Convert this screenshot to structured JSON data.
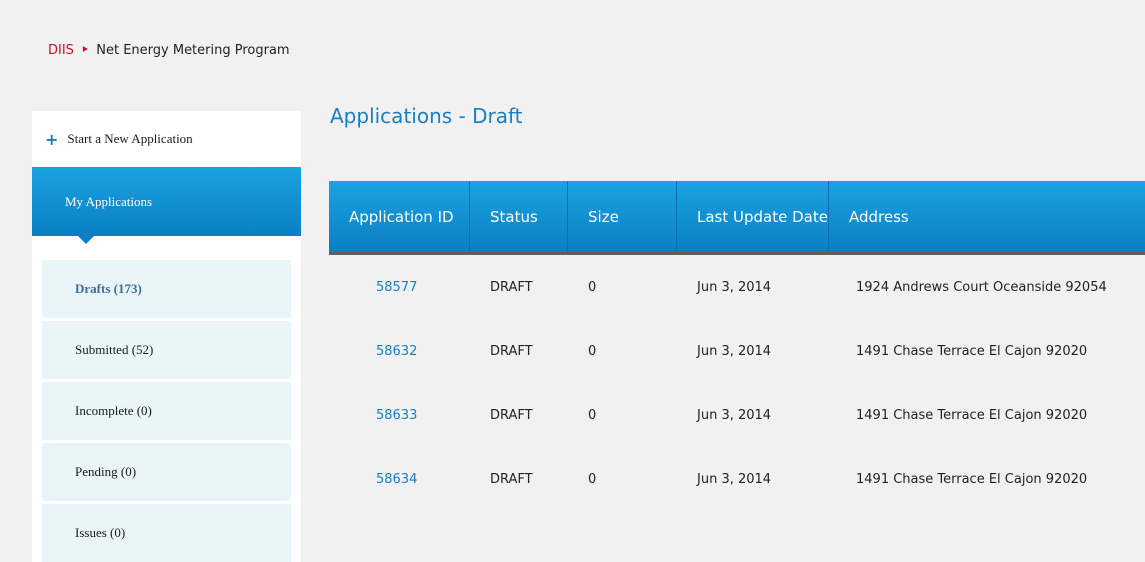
{
  "breadcrumb": {
    "root": "DIIS",
    "separator": "‣",
    "current": "Net Energy Metering Program"
  },
  "sidebar": {
    "new_application": "Start a New Application",
    "my_applications": "My Applications",
    "items": [
      {
        "label": "Drafts (173)",
        "active": true
      },
      {
        "label": "Submitted (52)"
      },
      {
        "label": "Incomplete (0)"
      },
      {
        "label": "Pending (0)"
      },
      {
        "label": "Issues (0)"
      }
    ]
  },
  "main": {
    "title": "Applications - Draft",
    "table": {
      "headers": [
        "Application ID",
        "Status",
        "Size",
        "Last Update Date",
        "Address"
      ],
      "rows": [
        {
          "id": "58577",
          "status": "DRAFT",
          "size": "0",
          "date": "Jun 3, 2014",
          "address": "1924 Andrews Court Oceanside 92054"
        },
        {
          "id": "58632",
          "status": "DRAFT",
          "size": "0",
          "date": "Jun 3, 2014",
          "address": "1491 Chase Terrace El Cajon 92020"
        },
        {
          "id": "58633",
          "status": "DRAFT",
          "size": "0",
          "date": "Jun 3, 2014",
          "address": "1491 Chase Terrace El Cajon 92020"
        },
        {
          "id": "58634",
          "status": "DRAFT",
          "size": "0",
          "date": "Jun 3, 2014",
          "address": "1491 Chase Terrace El Cajon 92020"
        }
      ]
    }
  },
  "colors": {
    "accent": "#1a7fc1",
    "brand_red": "#c8102e",
    "header_bg": "#0b7fc4",
    "sub_item_bg": "#eaf5f9"
  }
}
